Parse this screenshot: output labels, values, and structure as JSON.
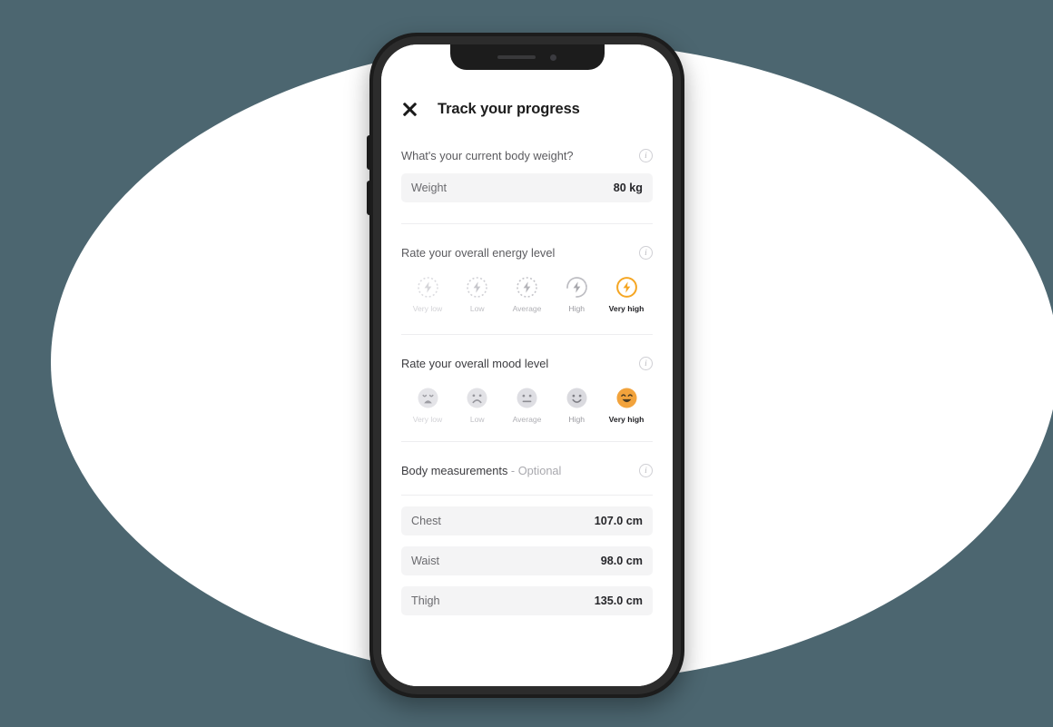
{
  "theme": {
    "background": "#4c6670",
    "backdrop": "#ffffff",
    "accent": "#f5a623",
    "accent_mood": "#f2a33c",
    "row_background": "#f4f4f5",
    "text_dark": "#1c1c1c",
    "text_muted": "#6a6a6e",
    "divider": "#ededf0"
  },
  "device": {
    "notch": {
      "speaker_icon": "speaker-grille-icon",
      "camera_icon": "front-camera-icon"
    },
    "buttons": [
      "volume-up-button",
      "volume-down-button"
    ]
  },
  "header": {
    "close_icon": "close-icon",
    "title": "Track your progress"
  },
  "weight_section": {
    "question": "What's your current body weight?",
    "info_icon": "info-icon",
    "row": {
      "label": "Weight",
      "value": "80 kg"
    }
  },
  "energy_section": {
    "title": "Rate your overall energy level",
    "info_icon": "info-icon",
    "icon_type": "bolt-icon",
    "selected_index": 4,
    "options": [
      {
        "label": "Very low"
      },
      {
        "label": "Low"
      },
      {
        "label": "Average"
      },
      {
        "label": "High"
      },
      {
        "label": "Very high"
      }
    ]
  },
  "mood_section": {
    "title": "Rate your overall mood level",
    "info_icon": "info-icon",
    "icon_type": "face-icon",
    "selected_index": 4,
    "options": [
      {
        "label": "Very low",
        "face": "very-sad-face-icon"
      },
      {
        "label": "Low",
        "face": "sad-face-icon"
      },
      {
        "label": "Average",
        "face": "neutral-face-icon"
      },
      {
        "label": "High",
        "face": "happy-face-icon"
      },
      {
        "label": "Very high",
        "face": "very-happy-face-icon"
      }
    ]
  },
  "body_measurements_section": {
    "title": "Body measurements",
    "optional_suffix": " - Optional",
    "info_icon": "info-icon",
    "rows": [
      {
        "label": "Chest",
        "value": "107.0 cm"
      },
      {
        "label": "Waist",
        "value": "98.0 cm"
      },
      {
        "label": "Thigh",
        "value": "135.0 cm"
      }
    ]
  }
}
